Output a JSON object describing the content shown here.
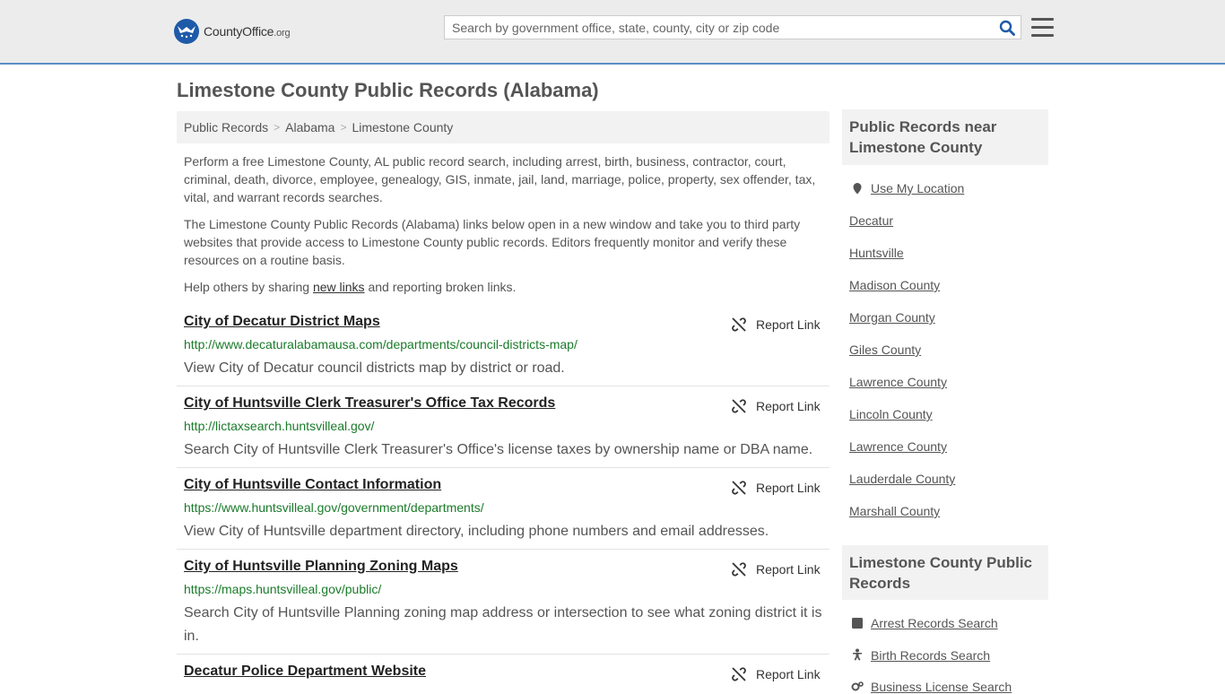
{
  "header": {
    "logo_text": "CountyOffice",
    "logo_tld": ".org",
    "search_placeholder": "Search by government office, state, county, city or zip code"
  },
  "page": {
    "title": "Limestone County Public Records (Alabama)"
  },
  "breadcrumb": [
    "Public Records",
    "Alabama",
    "Limestone County"
  ],
  "intro": {
    "p1": "Perform a free Limestone County, AL public record search, including arrest, birth, business, contractor, court, criminal, death, divorce, employee, genealogy, GIS, inmate, jail, land, marriage, police, property, sex offender, tax, vital, and warrant records searches.",
    "p2": "The Limestone County Public Records (Alabama) links below open in a new window and take you to third party websites that provide access to Limestone County public records. Editors frequently monitor and verify these resources on a routine basis.",
    "p3_pre": "Help others by sharing ",
    "p3_link": "new links",
    "p3_post": " and reporting broken links."
  },
  "report_label": "Report Link",
  "records": [
    {
      "title": "City of Decatur District Maps",
      "url": "http://www.decaturalabamausa.com/departments/council-districts-map/",
      "desc": "View City of Decatur council districts map by district or road."
    },
    {
      "title": "City of Huntsville Clerk Treasurer's Office Tax Records",
      "url": "http://lictaxsearch.huntsvilleal.gov/",
      "desc": "Search City of Huntsville Clerk Treasurer's Office's license taxes by ownership name or DBA name."
    },
    {
      "title": "City of Huntsville Contact Information",
      "url": "https://www.huntsvilleal.gov/government/departments/",
      "desc": "View City of Huntsville department directory, including phone numbers and email addresses."
    },
    {
      "title": "City of Huntsville Planning Zoning Maps",
      "url": "https://maps.huntsvilleal.gov/public/",
      "desc": "Search City of Huntsville Planning zoning map address or intersection to see what zoning district it is in."
    },
    {
      "title": "Decatur Police Department Website",
      "url": "",
      "desc": ""
    }
  ],
  "sidebar": {
    "near_title": "Public Records near Limestone County",
    "use_location": "Use My Location",
    "near_links": [
      "Decatur",
      "Huntsville",
      "Madison County",
      "Morgan County",
      "Giles County",
      "Lawrence County",
      "Lincoln County",
      "Lawrence County",
      "Lauderdale County",
      "Marshall County"
    ],
    "records_title": "Limestone County Public Records",
    "record_links": [
      "Arrest Records Search",
      "Birth Records Search",
      "Business License Search"
    ]
  }
}
